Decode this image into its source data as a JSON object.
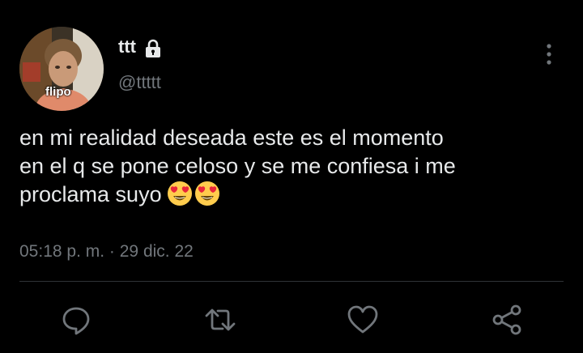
{
  "tweet": {
    "author": {
      "display_name": "ttt",
      "handle": "@ttttt",
      "avatar_caption": "flipo",
      "protected_icon": "lock-icon"
    },
    "text_lines": [
      "en mi realidad deseada este es el momento",
      "en el q se pone celoso y se me confiesa i me",
      "proclama suyo"
    ],
    "emojis": [
      "smiling-face-with-heart-eyes",
      "smiling-face-with-heart-eyes"
    ],
    "time": "05:18 p. m.",
    "separator": "·",
    "date": "29 dic. 22",
    "actions": [
      {
        "name": "reply",
        "icon": "reply-icon"
      },
      {
        "name": "retweet",
        "icon": "retweet-icon"
      },
      {
        "name": "like",
        "icon": "heart-icon"
      },
      {
        "name": "share",
        "icon": "share-icon"
      }
    ],
    "menu_icon": "more-vertical-icon"
  },
  "colors": {
    "background": "#000000",
    "primary_text": "#e7e9ea",
    "secondary_text": "#71767b",
    "divider": "#2f3336"
  }
}
